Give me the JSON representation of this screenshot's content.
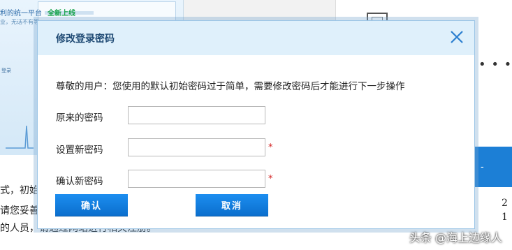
{
  "background": {
    "thumb_title": "利的统一平台",
    "thumb_badge": "全新上线",
    "thumb_subtitle": "业，无话不有等",
    "thumb_label": "登录",
    "text_lines": [
      "式，初始",
      "请您妥善",
      "的人员，请通过网站进行相关注册。"
    ],
    "right_text_1": "2",
    "right_text_2": "1",
    "right_dots": "• • •",
    "right_band_text": "-"
  },
  "dialog": {
    "title": "修改登录密码",
    "notice": "尊敬的用户：您使用的默认初始密码过于简单，需要修改密码后才能进行下一步操作",
    "fields": [
      {
        "label": "原来的密码",
        "value": "",
        "required": false
      },
      {
        "label": "设置新密码",
        "value": "",
        "required": true
      },
      {
        "label": "确认新密码",
        "value": "",
        "required": true
      }
    ],
    "required_mark": "*",
    "confirm_label": "确认",
    "cancel_label": "取消"
  },
  "watermark": "头条 @海上边缘人",
  "colors": {
    "header_bg": "#dff0fb",
    "button_blue": "#1c8ef0",
    "required_red": "#d21f1f",
    "band_blue": "#1c7fd6"
  },
  "icons": {
    "close": "close-icon"
  }
}
